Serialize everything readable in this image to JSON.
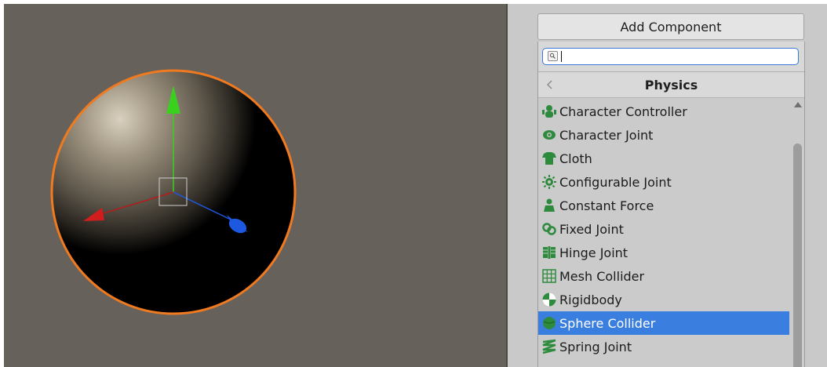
{
  "inspector": {
    "add_component_label": "Add Component",
    "search": {
      "value": "",
      "icon": "search-icon"
    },
    "category_title": "Physics",
    "back_icon": "chevron-left-icon",
    "accent_color": "#3a7ee0",
    "items": [
      {
        "label": "Character Controller",
        "icon": "character-controller-icon",
        "selected": false
      },
      {
        "label": "Character Joint",
        "icon": "character-joint-icon",
        "selected": false
      },
      {
        "label": "Cloth",
        "icon": "cloth-icon",
        "selected": false
      },
      {
        "label": "Configurable Joint",
        "icon": "configurable-joint-icon",
        "selected": false
      },
      {
        "label": "Constant Force",
        "icon": "constant-force-icon",
        "selected": false
      },
      {
        "label": "Fixed Joint",
        "icon": "fixed-joint-icon",
        "selected": false
      },
      {
        "label": "Hinge Joint",
        "icon": "hinge-joint-icon",
        "selected": false
      },
      {
        "label": "Mesh Collider",
        "icon": "mesh-collider-icon",
        "selected": true,
        "_note": "placeholder"
      },
      {
        "label": "Rigidbody",
        "icon": "rigidbody-icon",
        "selected": false
      },
      {
        "label": "Sphere Collider",
        "icon": "sphere-collider-icon",
        "selected": true
      },
      {
        "label": "Spring Joint",
        "icon": "spring-joint-icon",
        "selected": false
      }
    ]
  },
  "scene": {
    "object": "sphere",
    "outline_color": "#f07a1f",
    "gizmo": {
      "y_axis_color": "#39d11d",
      "x_axis_color": "#d11d1d",
      "z_axis_color": "#1d58e0"
    }
  }
}
